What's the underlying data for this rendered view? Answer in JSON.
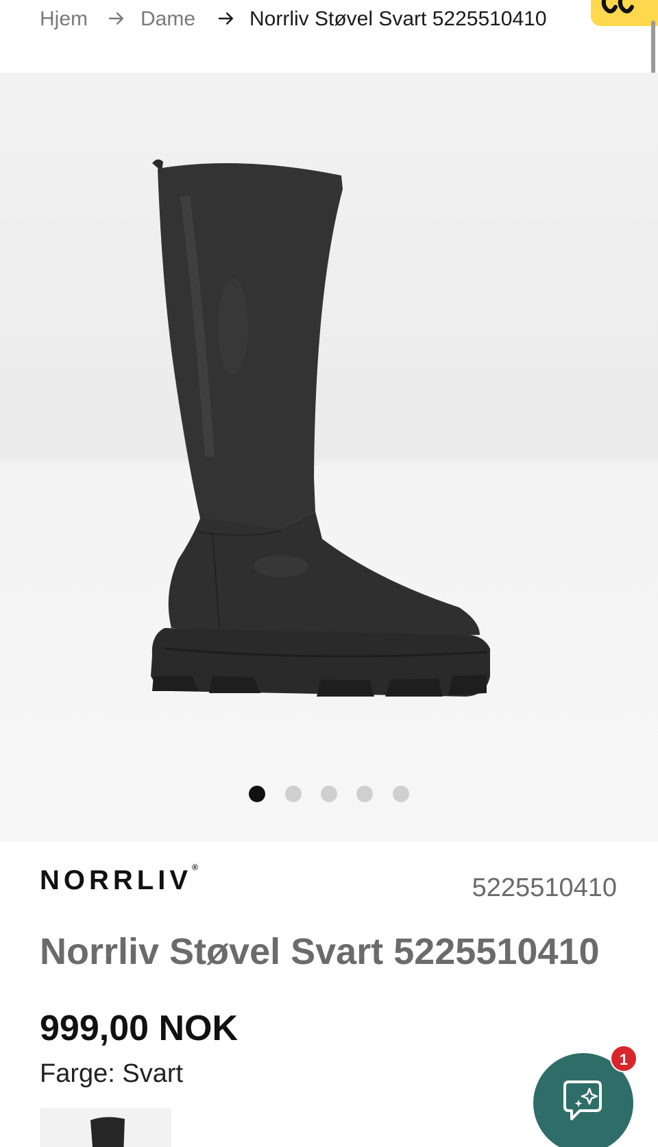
{
  "breadcrumb": {
    "items": [
      {
        "label": "Hjem"
      },
      {
        "label": "Dame"
      },
      {
        "label": "Norrliv Støvel Svart 5225510410"
      }
    ]
  },
  "gallery": {
    "image_alt": "Norrliv Støvel Svart",
    "slide_count": 5,
    "active_slide": 1
  },
  "product": {
    "brand": "NORRLIV",
    "brand_mark": "®",
    "sku": "5225510410",
    "title": "Norrliv Støvel Svart 5225510410",
    "price": "999,00 NOK",
    "color_text": "Farge: Svart"
  },
  "chat": {
    "badge_count": "1",
    "icon": "chat-sparkle-icon"
  },
  "colors": {
    "chat_bg": "#2f6e68",
    "badge_bg": "#d8262b",
    "promo_bg": "#ffd84d",
    "dot_active": "#111111",
    "dot_inactive": "#cfcfcf"
  }
}
